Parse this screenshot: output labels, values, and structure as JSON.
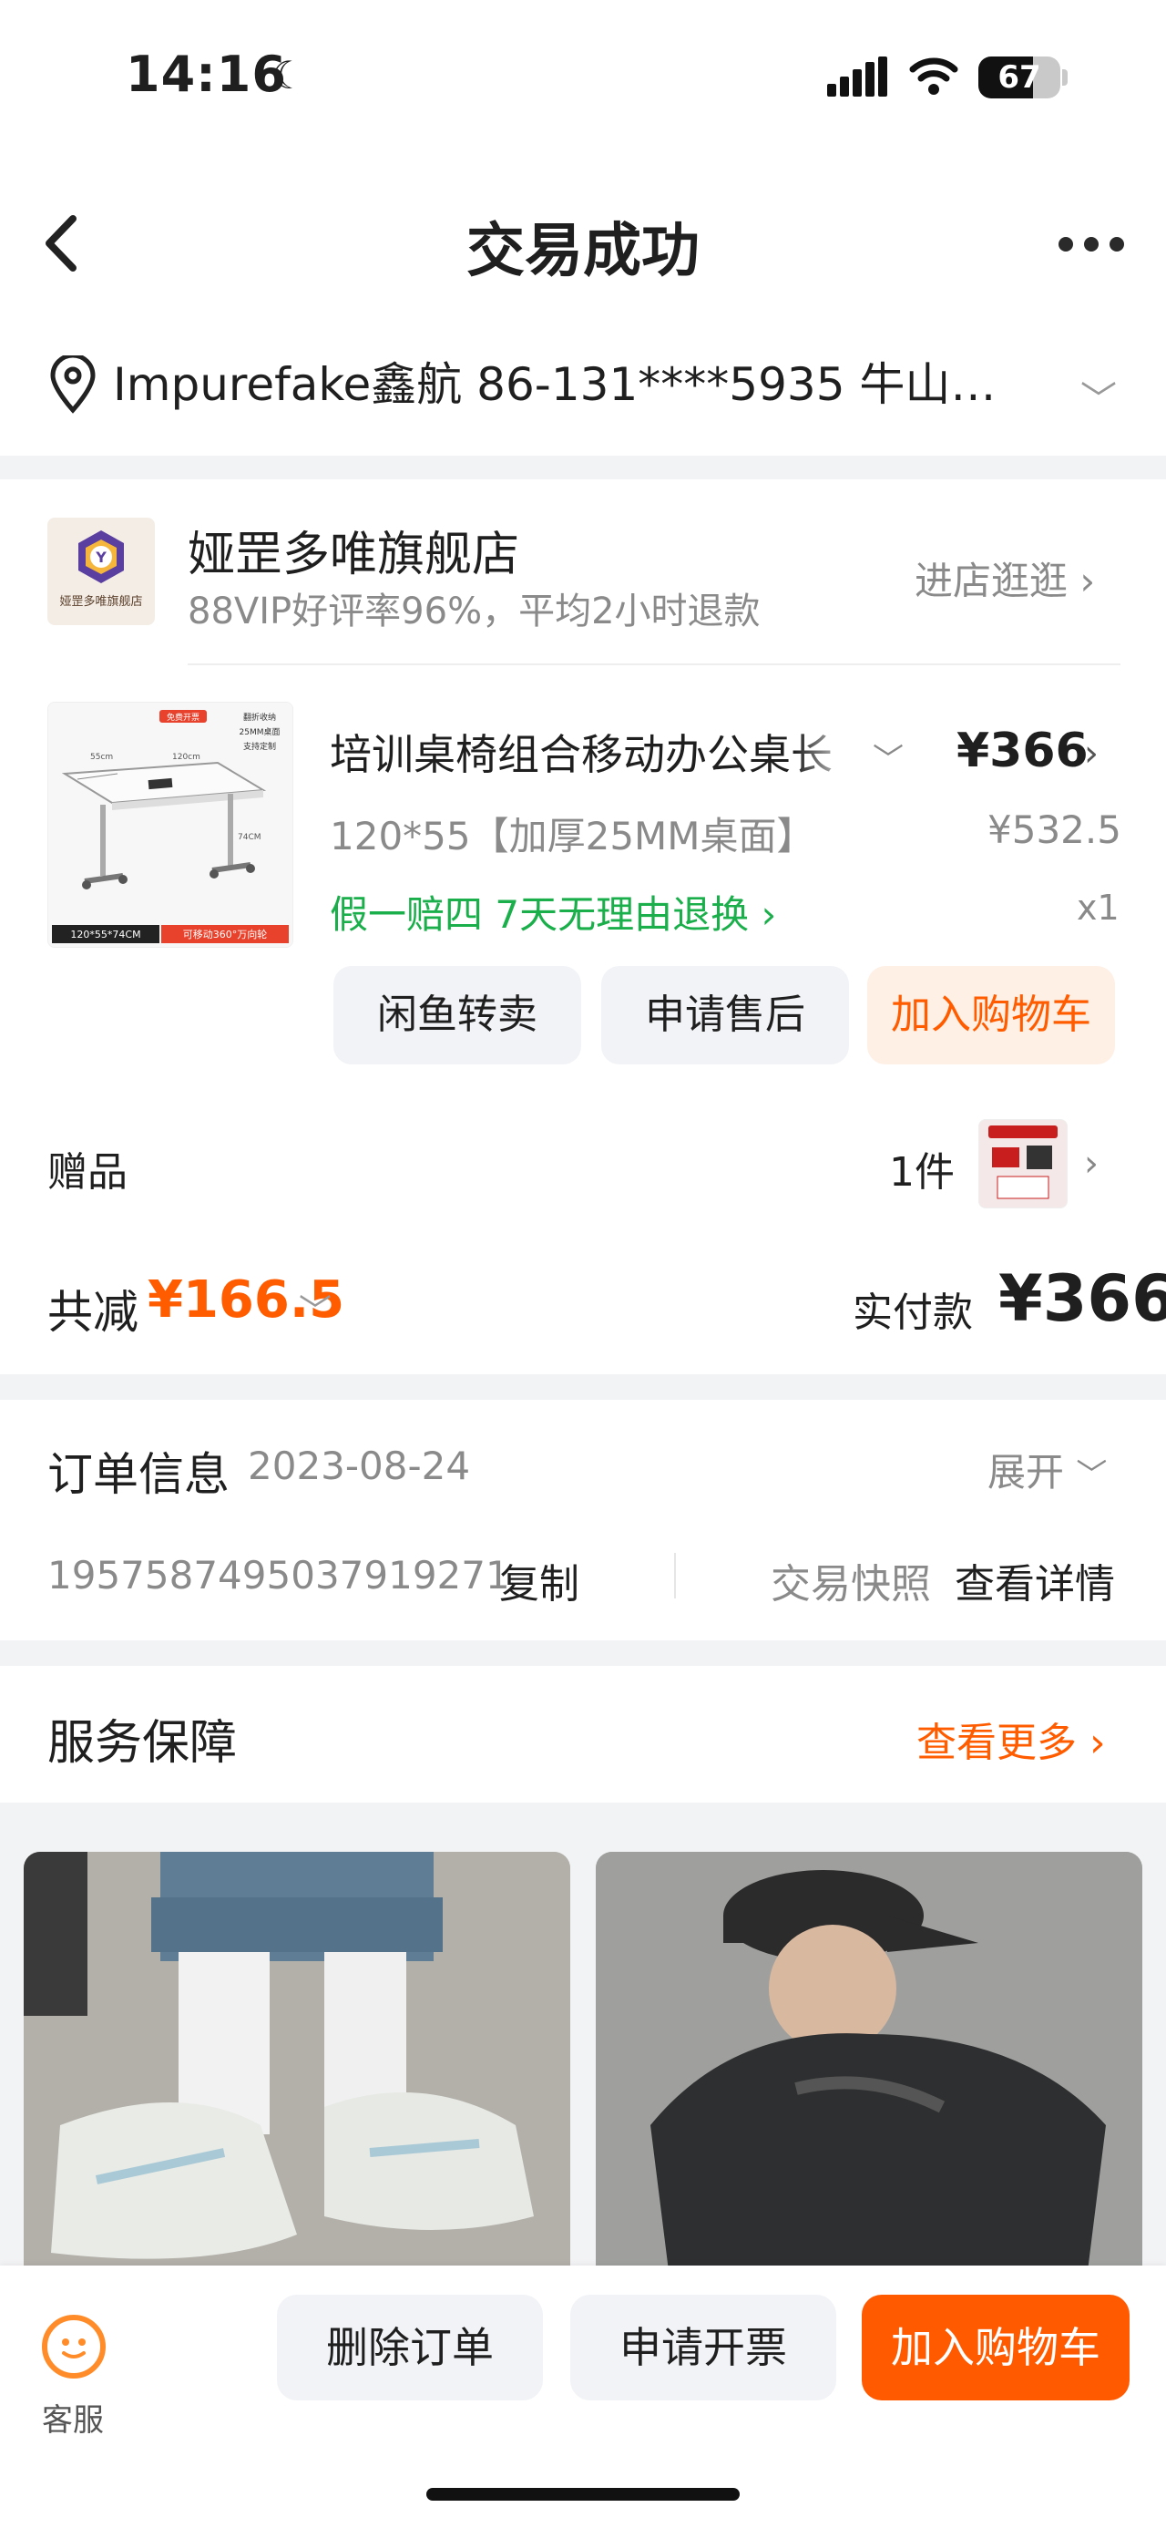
{
  "status_bar": {
    "time": "14:16",
    "battery": "67",
    "battery_level": 0.67
  },
  "nav": {
    "title": "交易成功"
  },
  "address": {
    "text": "Impurefake鑫航  86-131****5935  牛山堑..."
  },
  "store": {
    "name": "娅罡多唯旗舰店",
    "logo_text": "娅罡多唯旗舰店",
    "subtitle": "88VIP好评率96%，平均2小时退款",
    "visit_label": "进店逛逛"
  },
  "product": {
    "title": "培训桌椅组合移动办公桌长",
    "spec": "120*55【加厚25MM桌面】",
    "price": "¥366",
    "original_price": "¥532.5",
    "promise": "假一赔四  7天无理由退换",
    "quantity": "x1",
    "image_badges": {
      "tag": "免费开票",
      "f1": "翻折收纳",
      "f2": "25MM桌面",
      "f3": "支持定制",
      "dim": "120*55*74CM",
      "caster": "可移动360°万向轮",
      "w": "120cm",
      "d": "55cm",
      "h": "74CM"
    }
  },
  "actions": {
    "resell": "闲鱼转卖",
    "after_sale": "申请售后",
    "add_to_cart": "加入购物车"
  },
  "gift": {
    "label": "赠品",
    "count": "1件"
  },
  "totals": {
    "discount_label": "共减",
    "discount_value": "¥166.5",
    "paid_label": "实付款",
    "paid_value": "¥366"
  },
  "order_info": {
    "title": "订单信息",
    "date": "2023-08-24",
    "expand_label": "展开",
    "order_number": "1957587495037919271",
    "copy_label": "复制",
    "snapshot_label": "交易快照",
    "detail_label": "查看详情"
  },
  "service": {
    "title": "服务保障",
    "more_label": "查看更多"
  },
  "bottom_bar": {
    "service_label": "客服",
    "delete_label": "删除订单",
    "invoice_label": "申请开票",
    "cart_label": "加入购物车"
  },
  "colors": {
    "accent": "#ff5a00",
    "green": "#1aaf4b",
    "gray_text": "#8a8a8a"
  }
}
